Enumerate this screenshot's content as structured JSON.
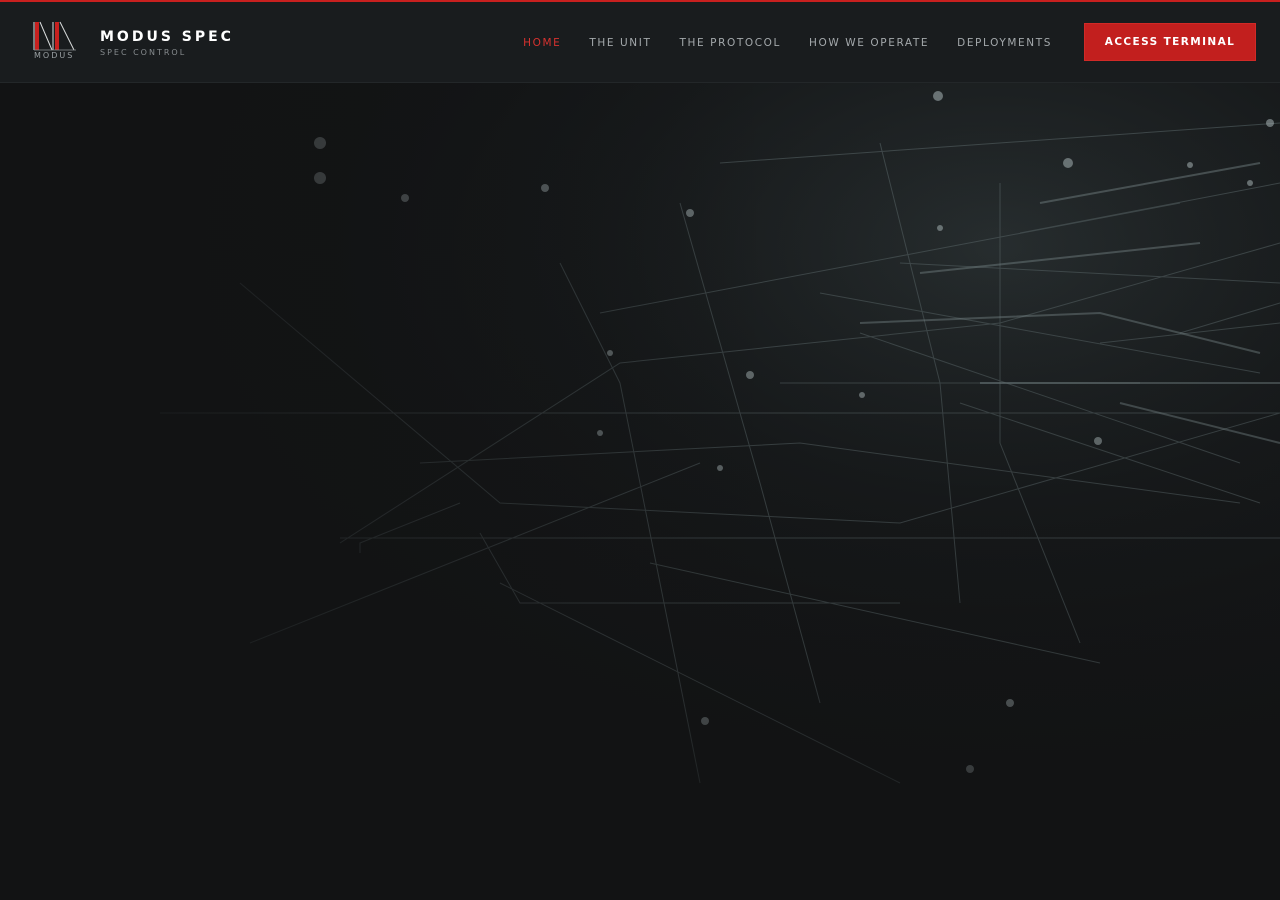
{
  "brand": {
    "logo_caption": "MODUS",
    "title": "MODUS SPEC",
    "subtitle": "SPEC CONTROL",
    "accent_color": "#c8201f"
  },
  "nav": {
    "items": [
      {
        "label": "HOME",
        "active": true
      },
      {
        "label": "THE UNIT",
        "active": false
      },
      {
        "label": "THE PROTOCOL",
        "active": false
      },
      {
        "label": "HOW WE OPERATE",
        "active": false
      },
      {
        "label": "DEPLOYMENTS",
        "active": false
      }
    ],
    "cta_label": "ACCESS TERMINAL"
  },
  "hero": {
    "background_description_icon": "circuit-network-graphic",
    "background_color": "#121314"
  }
}
